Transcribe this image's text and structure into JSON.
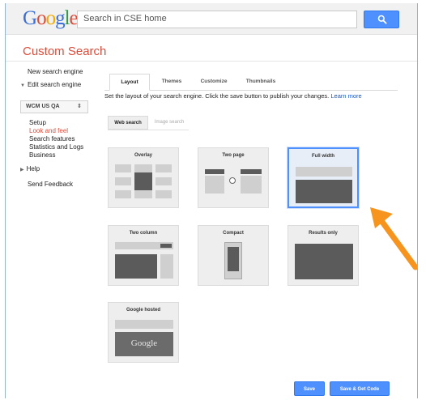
{
  "header": {
    "logo_letters": [
      {
        "char": "G",
        "color": "#3b6fd6"
      },
      {
        "char": "o",
        "color": "#dd4b39"
      },
      {
        "char": "o",
        "color": "#f2a900"
      },
      {
        "char": "g",
        "color": "#3b6fd6"
      },
      {
        "char": "l",
        "color": "#2e9b47"
      },
      {
        "char": "e",
        "color": "#dd4b39"
      }
    ],
    "search_placeholder": "Search in CSE home",
    "search_icon": "magnifier-icon"
  },
  "page": {
    "title": "Custom Search"
  },
  "sidebar": {
    "new_engine": "New search engine",
    "edit_engine": "Edit search engine",
    "engine_select_value": "WCM US QA",
    "subitems": [
      "Setup",
      "Look and feel",
      "Search features",
      "Statistics and Logs",
      "Business"
    ],
    "active_subitem": "Look and feel",
    "help": "Help",
    "send_feedback": "Send Feedback"
  },
  "main": {
    "tabs": [
      "Layout",
      "Themes",
      "Customize",
      "Thumbnails"
    ],
    "selected_tab": "Layout",
    "description": "Set the layout of your search engine. Click the save button to publish your changes.",
    "learn_more": "Learn more",
    "subtabs": [
      "Web search",
      "Image search"
    ],
    "selected_subtab": "Web search",
    "layouts": [
      {
        "label": "Overlay"
      },
      {
        "label": "Two page"
      },
      {
        "label": "Full width",
        "selected": true
      },
      {
        "label": "Two column"
      },
      {
        "label": "Compact"
      },
      {
        "label": "Results only"
      },
      {
        "label": "Google hosted",
        "preview_text": "Google"
      }
    ]
  },
  "footer": {
    "save_label": "Save",
    "save_get_code_label": "Save & Get Code"
  },
  "colors": {
    "accent_blue": "#4d90fe",
    "title_red": "#dd4b39",
    "arrow_orange": "#f7941d"
  }
}
